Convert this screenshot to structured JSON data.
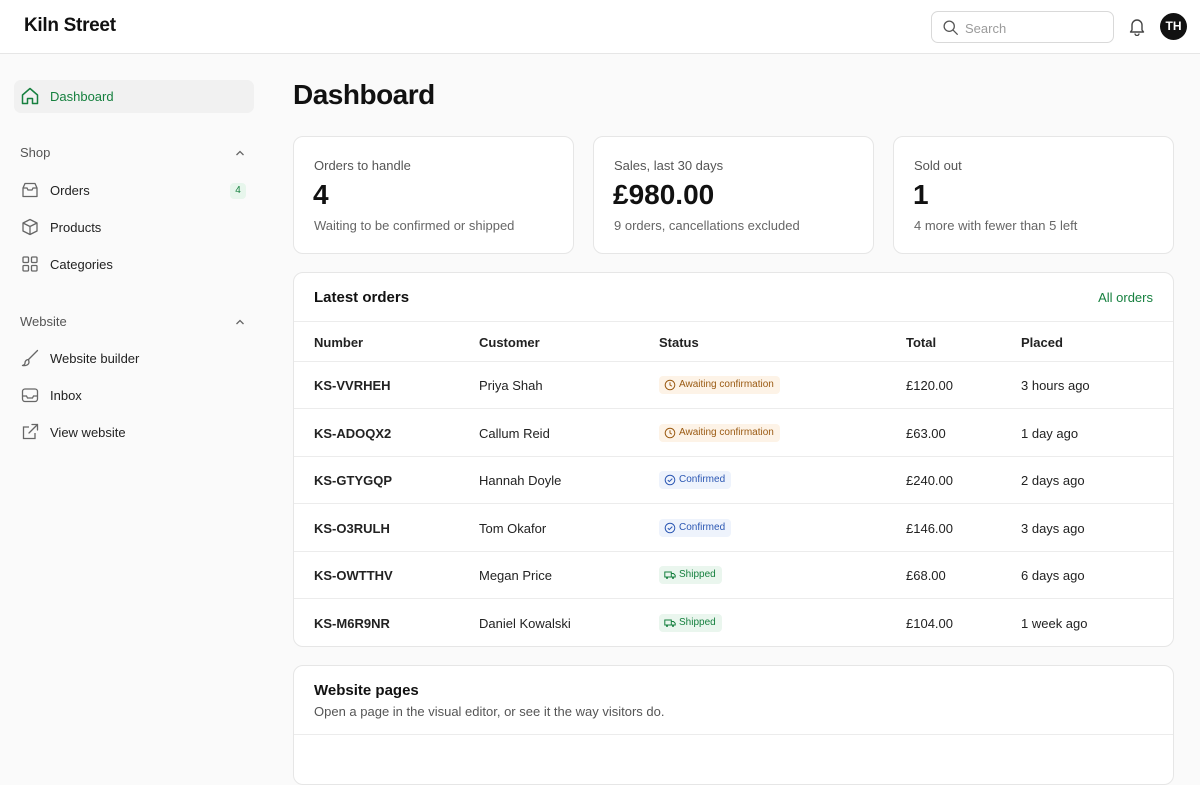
{
  "brand": "Kiln Street",
  "search": {
    "placeholder": "Search"
  },
  "user": {
    "initials": "TH"
  },
  "sidebar": {
    "dashboard": "Dashboard",
    "shop": {
      "title": "Shop",
      "items": [
        {
          "label": "Orders",
          "badge": "4"
        },
        {
          "label": "Products"
        },
        {
          "label": "Categories"
        }
      ]
    },
    "website": {
      "title": "Website",
      "items": [
        {
          "label": "Website builder"
        },
        {
          "label": "Inbox"
        },
        {
          "label": "View website"
        }
      ]
    }
  },
  "page_title": "Dashboard",
  "stats": [
    {
      "label": "Orders to handle",
      "value": "4",
      "sub": "Waiting to be confirmed or shipped"
    },
    {
      "label": "Sales, last 30 days",
      "value": "£980.00",
      "sub": "9 orders, cancellations excluded"
    },
    {
      "label": "Sold out",
      "value": "1",
      "sub": "4 more with fewer than 5 left"
    }
  ],
  "latest_orders": {
    "title": "Latest orders",
    "link": "All orders",
    "columns": [
      "Number",
      "Customer",
      "Status",
      "Total",
      "Placed"
    ],
    "rows": [
      {
        "number": "KS-VVRHEH",
        "customer": "Priya Shah",
        "status": "Awaiting confirmation",
        "total": "£120.00",
        "placed": "3 hours ago"
      },
      {
        "number": "KS-ADOQX2",
        "customer": "Callum Reid",
        "status": "Awaiting confirmation",
        "total": "£63.00",
        "placed": "1 day ago"
      },
      {
        "number": "KS-GTYGQP",
        "customer": "Hannah Doyle",
        "status": "Confirmed",
        "total": "£240.00",
        "placed": "2 days ago"
      },
      {
        "number": "KS-O3RULH",
        "customer": "Tom Okafor",
        "status": "Confirmed",
        "total": "£146.00",
        "placed": "3 days ago"
      },
      {
        "number": "KS-OWTTHV",
        "customer": "Megan Price",
        "status": "Shipped",
        "total": "£68.00",
        "placed": "6 days ago"
      },
      {
        "number": "KS-M6R9NR",
        "customer": "Daniel Kowalski",
        "status": "Shipped",
        "total": "£104.00",
        "placed": "1 week ago"
      }
    ]
  },
  "website_pages": {
    "title": "Website pages",
    "subtitle": "Open a page in the visual editor, or see it the way visitors do."
  },
  "colors": {
    "accent": "#16803f",
    "awaiting": "#9a5a12",
    "confirmed": "#2b57b3",
    "shipped": "#16803f"
  },
  "icons": {
    "search": "search-icon",
    "bell": "bell-icon",
    "dashboard": "home-icon",
    "orders": "inbox-tray-icon",
    "products": "box-icon",
    "categories": "grid-icon",
    "website_builder": "brush-icon",
    "inbox": "inbox-icon",
    "view_website": "external-link-icon"
  }
}
